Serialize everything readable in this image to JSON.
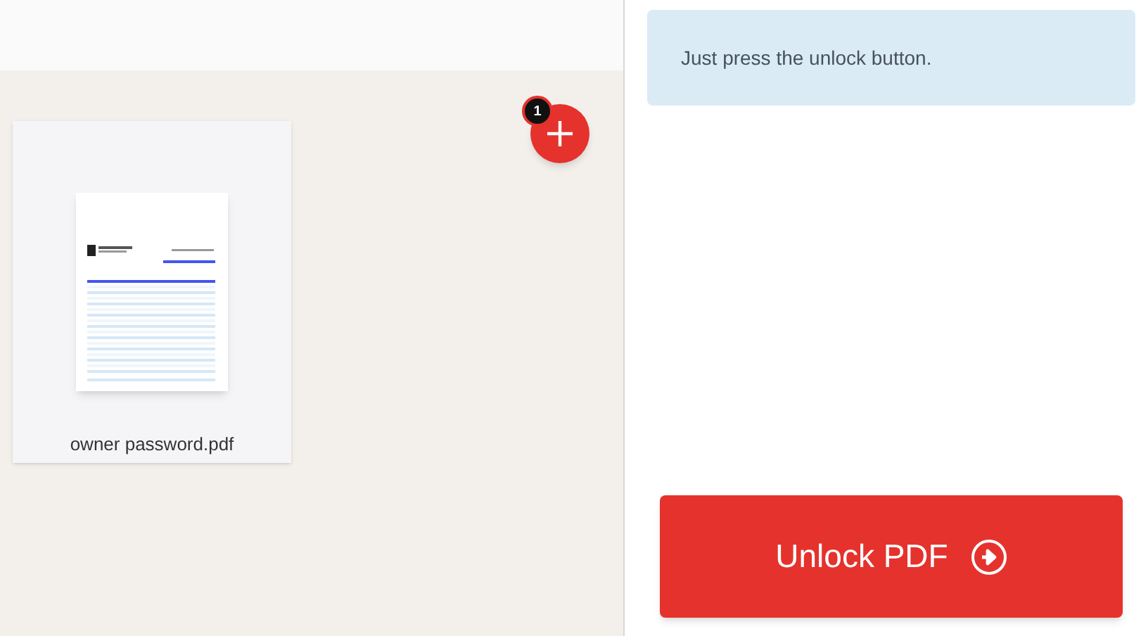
{
  "files": [
    {
      "name": "owner password.pdf"
    }
  ],
  "add_button": {
    "count": "1"
  },
  "info": {
    "text": "Just press the unlock button."
  },
  "action_button": {
    "label": "Unlock PDF"
  }
}
